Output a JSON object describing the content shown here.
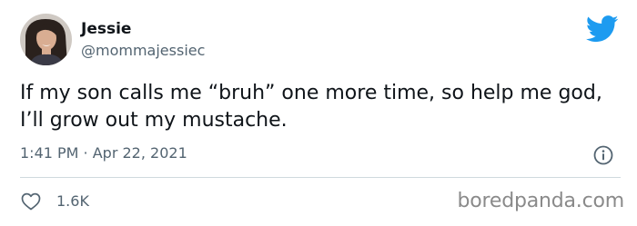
{
  "author": {
    "name": "Jessie",
    "handle": "@mommajessiec"
  },
  "tweet": {
    "text": "If my son calls me “bruh” one more time, so help me god, I’ll grow out my mustache.",
    "timestamp": "1:41 PM · Apr 22, 2021"
  },
  "actions": {
    "likes": "1.6K"
  },
  "watermark": "boredpanda.com",
  "icons": {
    "brand": "twitter-bird-icon",
    "info": "info-icon",
    "like": "heart-icon"
  },
  "colors": {
    "twitter_blue": "#1d9bf0",
    "secondary_text": "#536471",
    "divider": "#cfd9de"
  }
}
